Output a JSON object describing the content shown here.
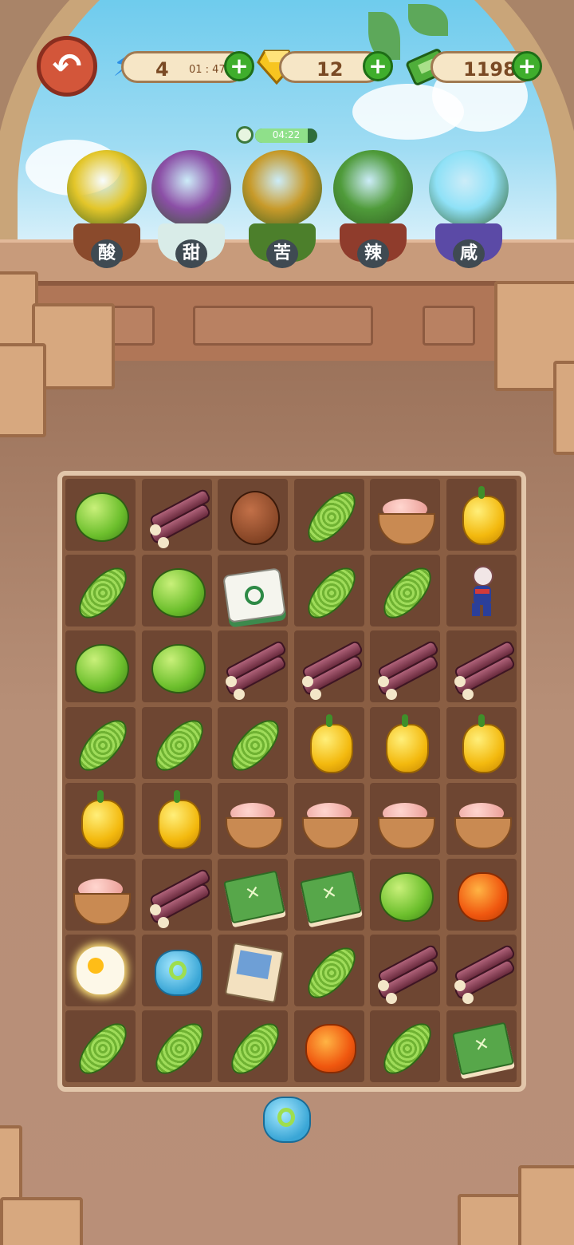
{
  "topbar": {
    "back_icon": "back-arrow-icon",
    "energy": {
      "icon": "lightning-icon",
      "value": "4",
      "timer": "01 : 47"
    },
    "gems": {
      "icon": "gem-icon",
      "value": "12"
    },
    "cash": {
      "icon": "cash-icon",
      "value": "1198"
    },
    "plus_icon": "plus-icon"
  },
  "mini_timer": {
    "icon": "clock-icon",
    "text": "04:22",
    "fill_fraction": 0.85
  },
  "plants": [
    {
      "label": "酸",
      "kind": "lemon-tree",
      "pot_color": "#8a4a2c",
      "foliage": "#e3c62a"
    },
    {
      "label": "甜",
      "kind": "sugarcane",
      "pot_color": "#d9ece8",
      "foliage": "#8b4fa6"
    },
    {
      "label": "苦",
      "kind": "bitter-tree",
      "pot_color": "#4c7f2b",
      "foliage": "#c79a2a"
    },
    {
      "label": "辣",
      "kind": "chili-plant",
      "pot_color": "#8f3c2c",
      "foliage": "#4f9b3a"
    },
    {
      "label": "咸",
      "kind": "salt-crystal",
      "pot_color": "#5b4aa6",
      "foliage": "#8fe1f7"
    }
  ],
  "board": {
    "rows": 8,
    "cols": 6,
    "grid": [
      [
        "lime",
        "sugarcane",
        "walnut",
        "bitter-melon",
        "meat-bowl",
        "yellow-pepper"
      ],
      [
        "bitter-melon",
        "lime",
        "mahjong-tile",
        "bitter-melon",
        "bitter-melon",
        "hero-figure"
      ],
      [
        "lime",
        "lime",
        "sugarcane",
        "sugarcane",
        "sugarcane",
        "sugarcane"
      ],
      [
        "bitter-melon",
        "bitter-melon",
        "bitter-melon",
        "yellow-pepper",
        "yellow-pepper",
        "yellow-pepper"
      ],
      [
        "yellow-pepper",
        "yellow-pepper",
        "meat-bowl",
        "meat-bowl",
        "meat-bowl",
        "meat-bowl"
      ],
      [
        "meat-bowl",
        "sugarcane",
        "recipe-book",
        "recipe-book",
        "lime",
        "orange-orb"
      ],
      [
        "egg",
        "jelly-sprout",
        "trading-card",
        "bitter-melon",
        "sugarcane",
        "sugarcane"
      ],
      [
        "bitter-melon",
        "bitter-melon",
        "bitter-melon",
        "orange-orb",
        "bitter-melon",
        "recipe-book"
      ]
    ]
  },
  "bottom_slot": {
    "item": "jelly-sprout"
  }
}
